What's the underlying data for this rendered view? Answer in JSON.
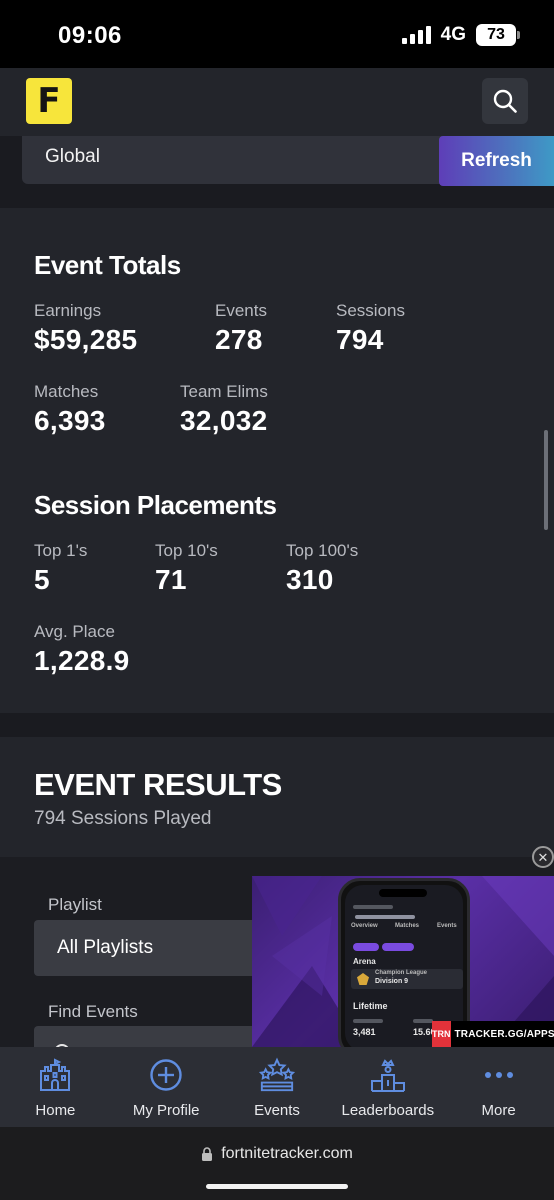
{
  "status_bar": {
    "time": "09:06",
    "network": "4G",
    "battery": "73"
  },
  "header": {
    "logo_letter": "F"
  },
  "filter": {
    "value": "Global",
    "refresh_label": "Refresh"
  },
  "event_totals": {
    "heading": "Event Totals",
    "stats": [
      {
        "label": "Earnings",
        "value": "$59,285"
      },
      {
        "label": "Events",
        "value": "278"
      },
      {
        "label": "Sessions",
        "value": "794"
      },
      {
        "label": "Matches",
        "value": "6,393"
      },
      {
        "label": "Team Elims",
        "value": "32,032"
      }
    ]
  },
  "session_placements": {
    "heading": "Session Placements",
    "stats": [
      {
        "label": "Top 1's",
        "value": "5"
      },
      {
        "label": "Top 10's",
        "value": "71"
      },
      {
        "label": "Top 100's",
        "value": "310"
      },
      {
        "label": "Avg. Place",
        "value": "1,228.9"
      }
    ]
  },
  "event_results": {
    "title": "EVENT RESULTS",
    "subtitle": "794 Sessions Played",
    "playlist_label": "Playlist",
    "playlist_value": "All Playlists",
    "find_events_label": "Find Events"
  },
  "ad": {
    "brand_badge": "TRN",
    "url": "TRACKER.GG/APPS",
    "phone_tabs": [
      "Overview",
      "Matches",
      "Events"
    ],
    "phone_section_1": "Arena",
    "phone_league": "Champion League",
    "phone_division": "Division 9",
    "phone_section_2": "Lifetime",
    "phone_stat_1": "3,481",
    "phone_stat_2": "15.60"
  },
  "bottom_nav": {
    "items": [
      {
        "label": "Home",
        "icon": "castle-icon"
      },
      {
        "label": "My Profile",
        "icon": "plus-circle-icon"
      },
      {
        "label": "Events",
        "icon": "stars-podium-icon"
      },
      {
        "label": "Leaderboards",
        "icon": "podium-icon"
      },
      {
        "label": "More",
        "icon": "more-dots-icon"
      }
    ]
  },
  "browser": {
    "url": "fortnitetracker.com"
  },
  "colors": {
    "accent_yellow": "#f7e53b",
    "nav_icon_blue": "#5f8de0",
    "refresh_gradient_start": "#5e3eb8",
    "refresh_gradient_end": "#3e9ac6"
  }
}
